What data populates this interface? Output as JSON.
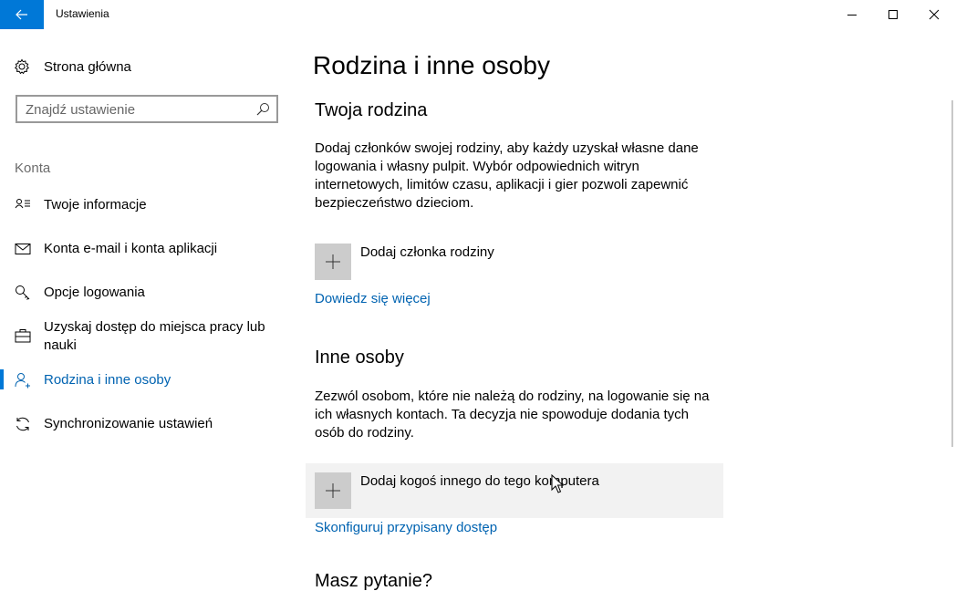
{
  "window": {
    "title": "Ustawienia",
    "accent_color": "#0078d7",
    "link_color": "#0063b1"
  },
  "titlebar": {
    "back_icon": "back-arrow-icon",
    "minimize_icon": "minimize-icon",
    "maximize_icon": "maximize-icon",
    "close_icon": "close-icon"
  },
  "sidebar": {
    "home": {
      "label": "Strona główna",
      "icon": "gear-icon"
    },
    "search": {
      "placeholder": "Znajdź ustawienie",
      "icon": "search-icon"
    },
    "section_label": "Konta",
    "items": [
      {
        "label": "Twoje informacje",
        "icon": "person-card-icon",
        "active": false
      },
      {
        "label": "Konta e-mail i konta aplikacji",
        "icon": "mail-icon",
        "active": false
      },
      {
        "label": "Opcje logowania",
        "icon": "key-icon",
        "active": false
      },
      {
        "label": "Uzyskaj dostęp do miejsca pracy lub nauki",
        "icon": "briefcase-icon",
        "active": false
      },
      {
        "label": "Rodzina i inne osoby",
        "icon": "person-add-icon",
        "active": true
      },
      {
        "label": "Synchronizowanie ustawień",
        "icon": "sync-icon",
        "active": false
      }
    ]
  },
  "main": {
    "title": "Rodzina i inne osoby",
    "family": {
      "heading": "Twoja rodzina",
      "description": "Dodaj członków swojej rodziny, aby każdy uzyskał własne dane logowania i własny pulpit. Wybór odpowiednich witryn internetowych, limitów czasu, aplikacji i gier pozwoli zapewnić bezpieczeństwo dzieciom.",
      "add_label": "Dodaj członka rodziny",
      "learn_more": "Dowiedz się więcej"
    },
    "others": {
      "heading": "Inne osoby",
      "description": "Zezwól osobom, które nie należą do rodziny, na logowanie się na ich własnych kontach. Ta decyzja nie spowoduje dodania tych osób do rodziny.",
      "add_label": "Dodaj kogoś innego do tego komputera",
      "assigned_access": "Skonfiguruj przypisany dostęp"
    },
    "question_heading": "Masz pytanie?"
  }
}
